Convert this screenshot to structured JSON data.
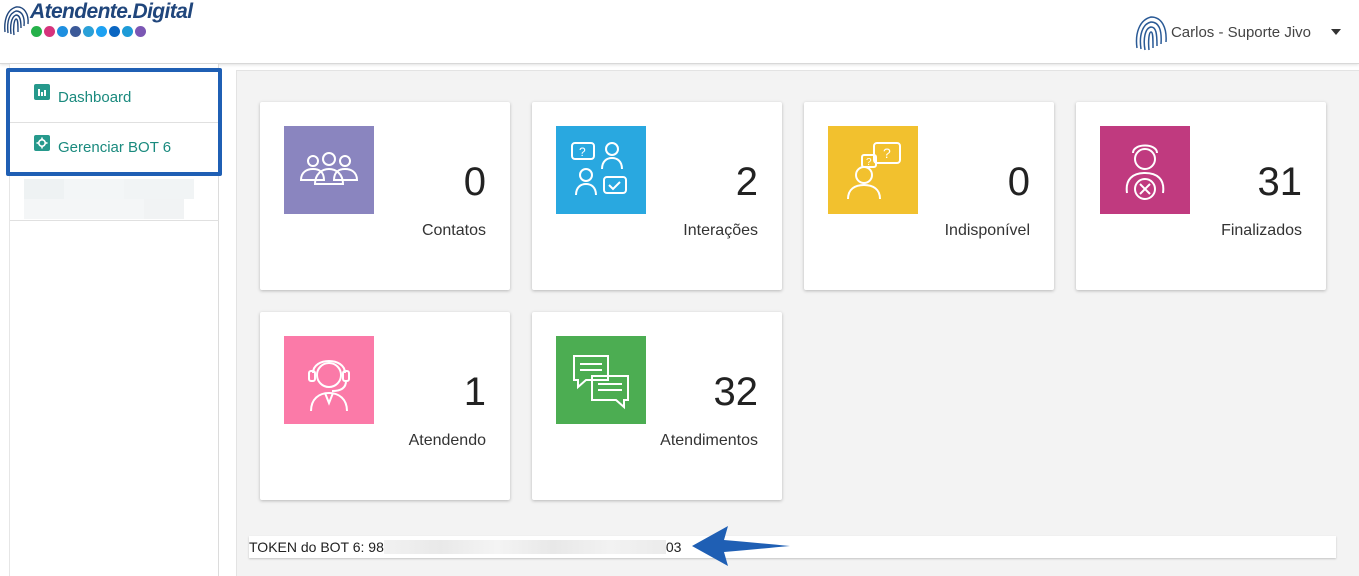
{
  "header": {
    "logo_text": "Atendente.Digital",
    "logo_dot_colors": [
      "#25b14a",
      "#d6337c",
      "#1e8fe0",
      "#3b5998",
      "#2aa0d8",
      "#1da1f2",
      "#0a66c2",
      "#1e9bd7",
      "#7b57b4"
    ],
    "user_name": "Carlos - Suporte Jivo"
  },
  "sidebar": {
    "items": [
      {
        "label": "Dashboard",
        "icon": "bar-chart-icon"
      },
      {
        "label": "Gerenciar BOT 6",
        "icon": "gear-icon"
      }
    ]
  },
  "cards": [
    {
      "value": "0",
      "label": "Contatos",
      "color": "#8a85bf",
      "icon": "group-icon"
    },
    {
      "value": "2",
      "label": "Interações",
      "color": "#29a8e0",
      "icon": "conversation-icon"
    },
    {
      "value": "0",
      "label": "Indisponível",
      "color": "#f2c12e",
      "icon": "question-person-icon"
    },
    {
      "value": "31",
      "label": "Finalizados",
      "color": "#c03a7f",
      "icon": "person-cancel-icon"
    },
    {
      "value": "1",
      "label": "Atendendo",
      "color": "#fb7aa8",
      "icon": "headset-agent-icon"
    },
    {
      "value": "32",
      "label": "Atendimentos",
      "color": "#4cad52",
      "icon": "chat-bubbles-icon"
    }
  ],
  "token": {
    "prefix": "TOKEN do BOT 6: 98",
    "suffix": "03"
  },
  "accent": "#1f5fb4"
}
